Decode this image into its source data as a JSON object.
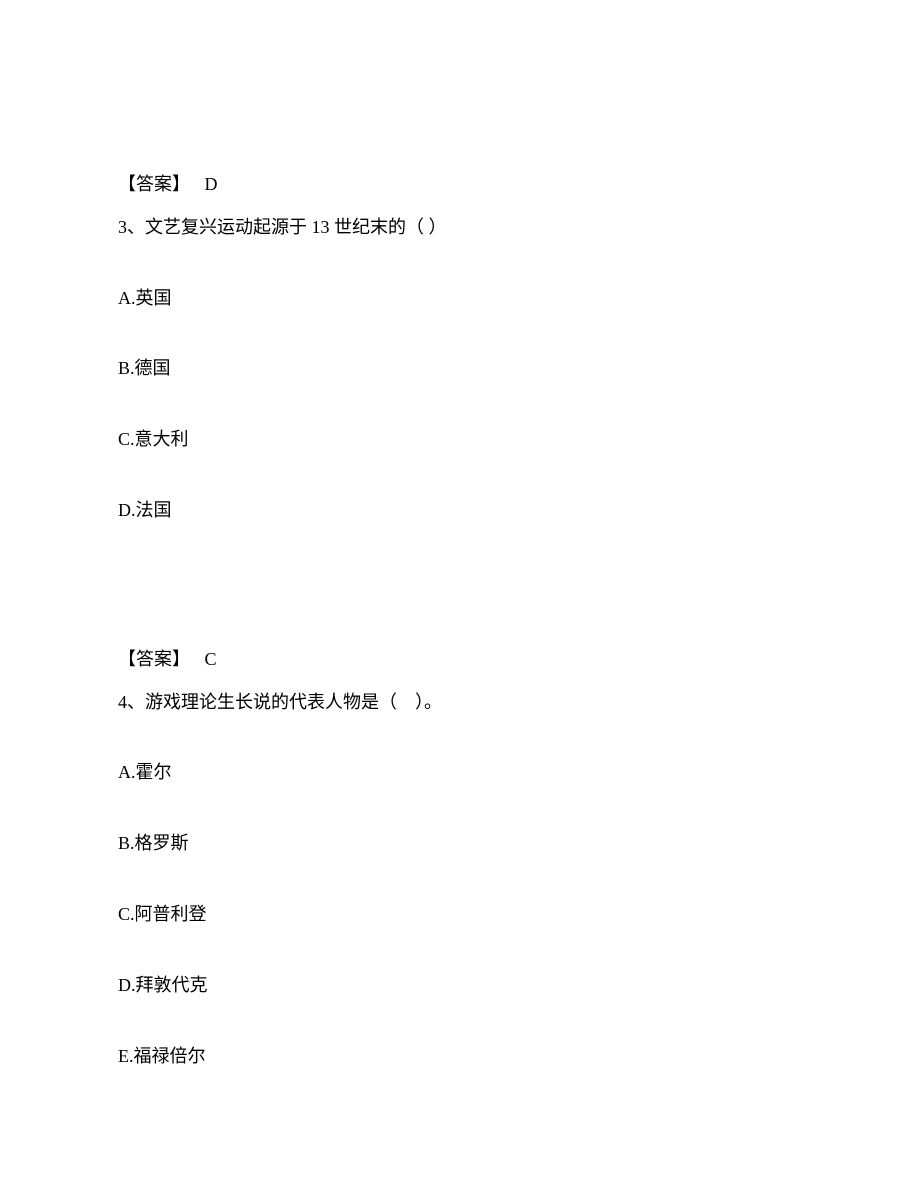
{
  "answer2": {
    "label": "【答案】",
    "value": "D"
  },
  "q3": {
    "number": "3、",
    "text_part1": "文艺复兴运动起源于 ",
    "text_num": "13",
    "text_part2": " 世纪末的（ ）",
    "options": {
      "a": {
        "prefix": "A.",
        "text": "英国"
      },
      "b": {
        "prefix": "B.",
        "text": "德国"
      },
      "c": {
        "prefix": "C.",
        "text": "意大利"
      },
      "d": {
        "prefix": "D.",
        "text": "法国"
      }
    }
  },
  "answer3": {
    "label": "【答案】",
    "value": "C"
  },
  "q4": {
    "number": "4、",
    "text": "游戏理论生长说的代表人物是（　）。",
    "options": {
      "a": {
        "prefix": "A.",
        "text": "霍尔"
      },
      "b": {
        "prefix": "B.",
        "text": "格罗斯"
      },
      "c": {
        "prefix": "C.",
        "text": "阿普利登"
      },
      "d": {
        "prefix": "D.",
        "text": "拜敦代克"
      },
      "e": {
        "prefix": "E.",
        "text": "福禄倍尔"
      }
    }
  }
}
